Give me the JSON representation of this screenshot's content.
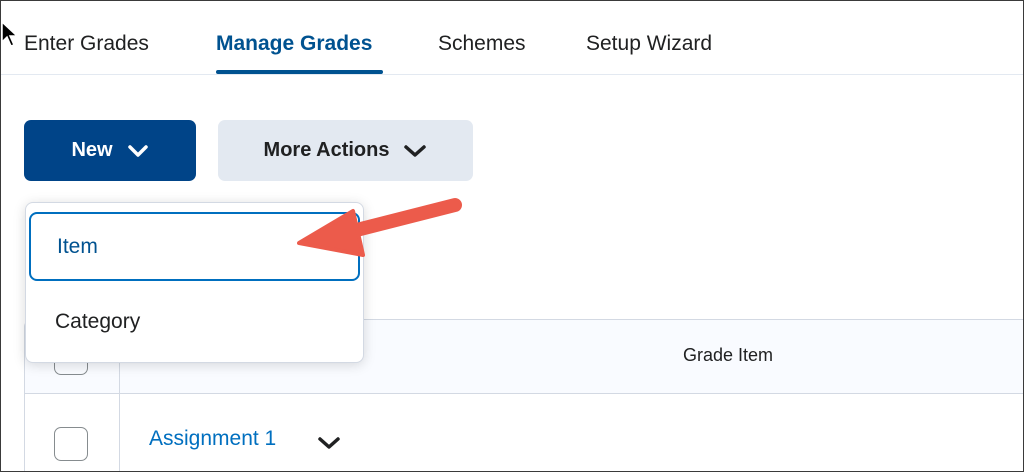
{
  "tabs": [
    {
      "label": "Enter Grades",
      "active": false
    },
    {
      "label": "Manage Grades",
      "active": true
    },
    {
      "label": "Schemes",
      "active": false
    },
    {
      "label": "Setup Wizard",
      "active": false
    }
  ],
  "toolbar": {
    "new_label": "New",
    "more_actions_label": "More Actions"
  },
  "new_menu": {
    "items": [
      {
        "label": "Item",
        "selected": true
      },
      {
        "label": "Category",
        "selected": false
      }
    ]
  },
  "table": {
    "columns": [
      "Grade Item"
    ],
    "rows": [
      {
        "name": "Assignment 1"
      }
    ]
  },
  "colors": {
    "primary": "#004488",
    "link": "#006fbf",
    "active_tab": "#005290",
    "secondary_button": "#e3e9f1",
    "annotation_arrow": "#ec5b4b"
  },
  "icons": {
    "cursor": "mouse-pointer-icon",
    "dropdown": "chevron-down-icon"
  }
}
